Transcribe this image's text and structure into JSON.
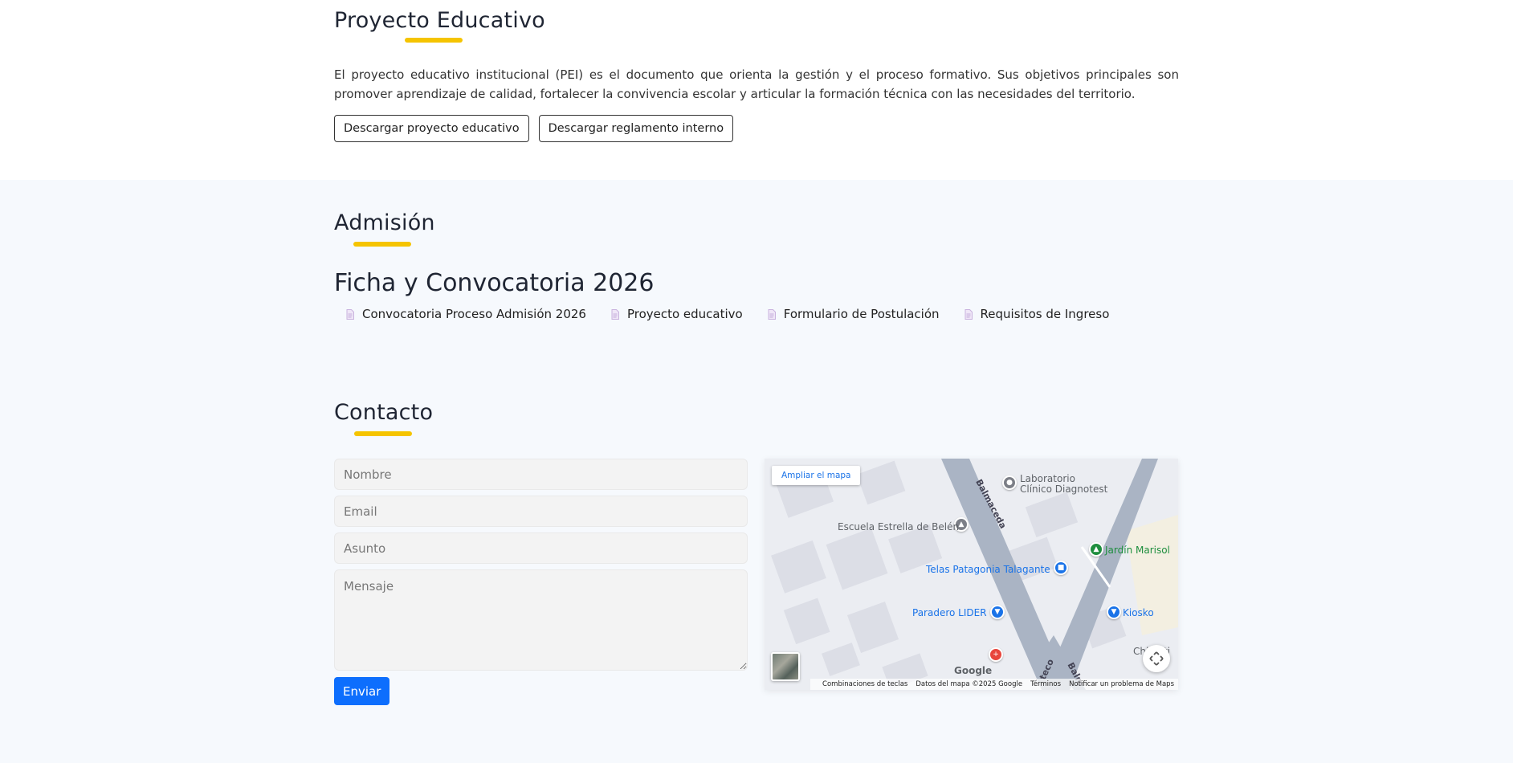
{
  "pei": {
    "title": "Proyecto Educativo",
    "text": "El proyecto educativo institucional (PEI) es el documento que orienta la gestión y el proceso formativo. Sus objetivos principales son promover aprendizaje de calidad, fortalecer la convivencia escolar y articular la formación técnica con las necesidades del territorio.",
    "buttons": [
      "Descargar proyecto educativo",
      "Descargar reglamento interno"
    ]
  },
  "admision": {
    "title": "Admisión",
    "subtitle": "Ficha y Convocatoria 2026",
    "documents": [
      "Convocatoria Proceso Admisión 2026",
      "Proyecto educativo",
      "Formulario de Postulación",
      "Requisitos de Ingreso"
    ]
  },
  "contacto": {
    "title": "Contacto",
    "placeholders": {
      "nombre": "Nombre",
      "email": "Email",
      "asunto": "Asunto",
      "mensaje": "Mensaje"
    },
    "submit": "Enviar"
  },
  "map": {
    "expand": "Ampliar el mapa",
    "labels": {
      "lab": "Laboratorio\nClínico Diagnotest",
      "escuela": "Escuela Estrella de Belén",
      "jardin": "Jardín Marisol",
      "telas": "Telas Patagonia Talagante",
      "paradero": "Paradero LIDER",
      "kiosko": "Kiosko",
      "chile": "ChileAti",
      "street1": "Balmaceda",
      "street2": "Balm",
      "street3": "teco",
      "google": "Google"
    },
    "footer": [
      "Combinaciones de teclas",
      "Datos del mapa ©2025 Google",
      "Términos",
      "Notificar un problema de Maps"
    ]
  },
  "colors": {
    "accent_underline": "#f5c400",
    "primary_button": "#0d6efd",
    "lower_background": "#f6f9fd"
  }
}
